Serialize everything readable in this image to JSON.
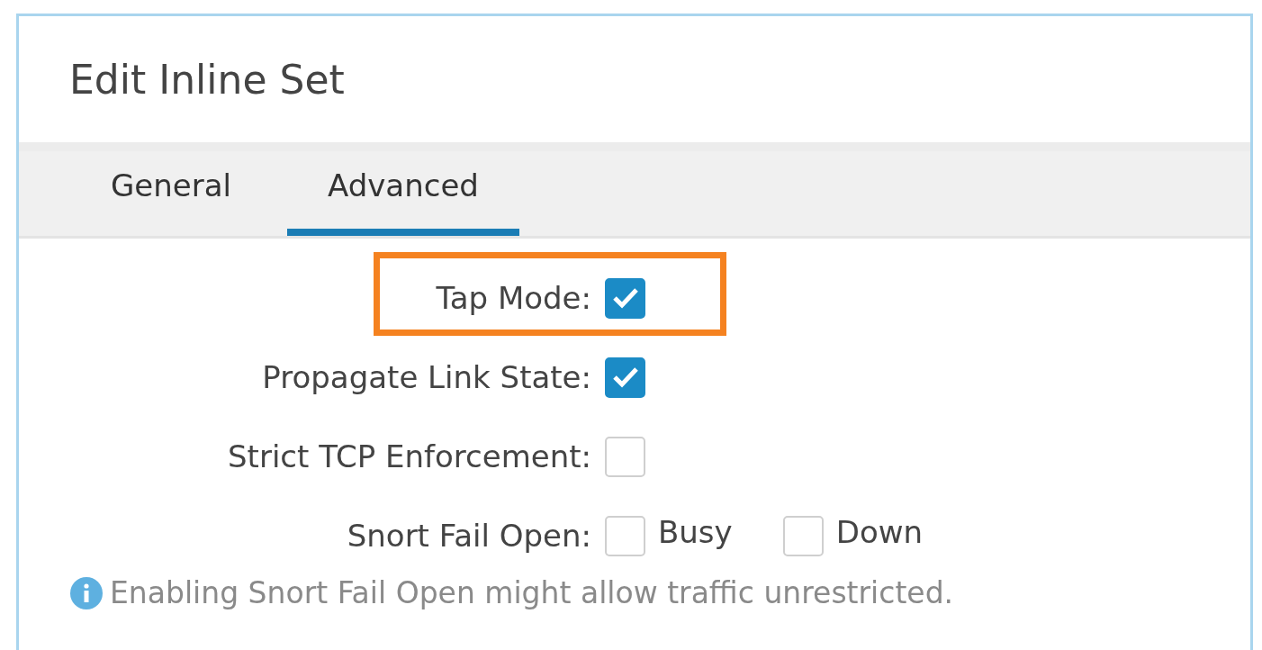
{
  "dialog": {
    "title": "Edit Inline Set"
  },
  "tabs": [
    {
      "label": "General",
      "selected": false
    },
    {
      "label": "Advanced",
      "selected": true
    }
  ],
  "fields": [
    {
      "label": "Tap Mode:",
      "highlighted": true,
      "checkboxes": [
        {
          "checked": true
        }
      ]
    },
    {
      "label": "Propagate Link State:",
      "highlighted": false,
      "checkboxes": [
        {
          "checked": true
        }
      ]
    },
    {
      "label": "Strict TCP Enforcement:",
      "highlighted": false,
      "checkboxes": [
        {
          "checked": false
        }
      ]
    },
    {
      "label": "Snort Fail Open:",
      "highlighted": false,
      "checkboxes": [
        {
          "label": "Busy",
          "checked": false
        },
        {
          "label": "Down",
          "checked": false
        }
      ]
    }
  ],
  "note": {
    "text": "Enabling Snort Fail Open might allow traffic unrestricted."
  }
}
